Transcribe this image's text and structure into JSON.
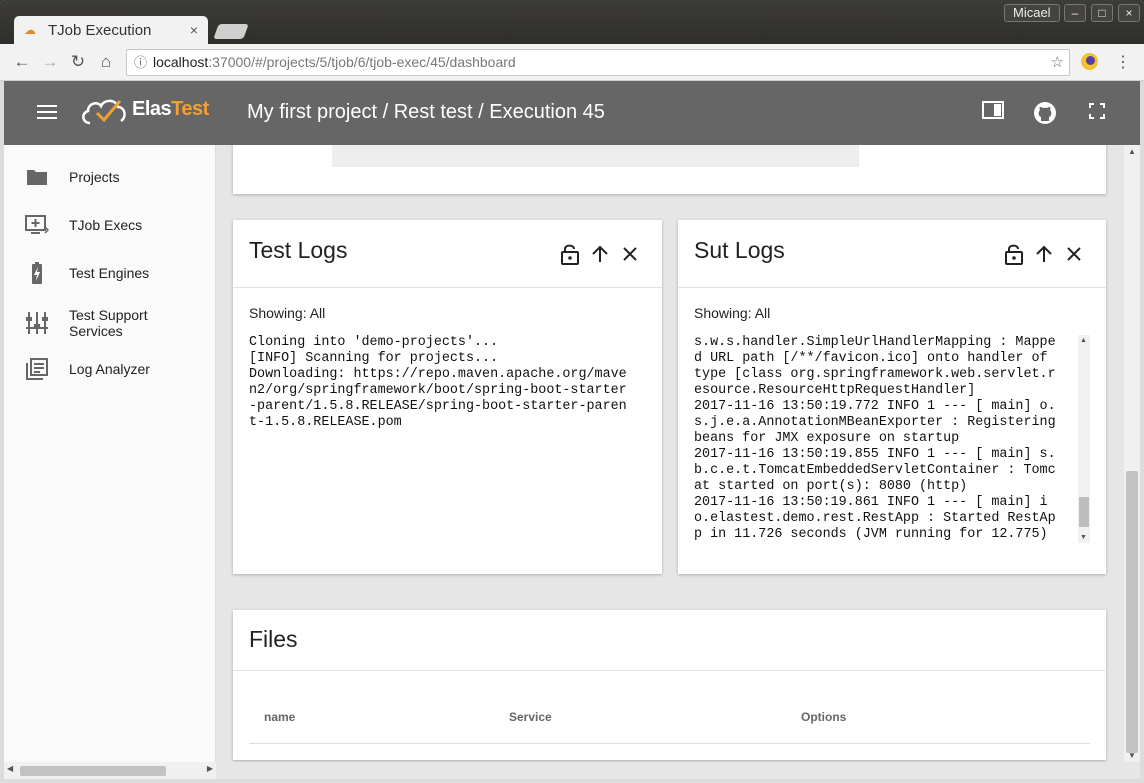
{
  "browser": {
    "tab_title": "TJob Execution",
    "tab_close": "×",
    "user_badge": "Micael",
    "window_controls": [
      "–",
      "□",
      "×"
    ],
    "url_host": "localhost",
    "url_path": ":37000/#/projects/5/tjob/6/tjob-exec/45/dashboard"
  },
  "appbar": {
    "brand_prefix": "Elas",
    "brand_suffix": "Test",
    "title": "My first project / Rest test / Execution 45"
  },
  "sidebar": {
    "items": [
      {
        "label": "Projects",
        "icon": "folder-icon"
      },
      {
        "label": "TJob Execs",
        "icon": "add-to-queue-icon"
      },
      {
        "label": "Test Engines",
        "icon": "battery-charging-icon"
      },
      {
        "label": "Test Support Services",
        "icon": "tune-sliders-icon"
      },
      {
        "label": "Log Analyzer",
        "icon": "library-books-icon"
      }
    ]
  },
  "test_logs": {
    "title": "Test Logs",
    "showing": "Showing: All",
    "content": "Cloning into 'demo-projects'...\n[INFO] Scanning for projects...\nDownloading: https://repo.maven.apache.org/mave\nn2/org/springframework/boot/spring-boot-starter\n-parent/1.5.8.RELEASE/spring-boot-starter-paren\nt-1.5.8.RELEASE.pom"
  },
  "sut_logs": {
    "title": "Sut Logs",
    "showing": "Showing: All",
    "content": "s.w.s.handler.SimpleUrlHandlerMapping : Mappe\nd URL path [/**/favicon.ico] onto handler of\ntype [class org.springframework.web.servlet.r\nesource.ResourceHttpRequestHandler]\n2017-11-16 13:50:19.772 INFO 1 --- [ main] o.\ns.j.e.a.AnnotationMBeanExporter : Registering\nbeans for JMX exposure on startup\n2017-11-16 13:50:19.855 INFO 1 --- [ main] s.\nb.c.e.t.TomcatEmbeddedServletContainer : Tomc\nat started on port(s): 8080 (http)\n2017-11-16 13:50:19.861 INFO 1 --- [ main] i\no.elastest.demo.rest.RestApp : Started RestAp\np in 11.726 seconds (JVM running for 12.775)"
  },
  "files": {
    "title": "Files",
    "columns": [
      "name",
      "Service",
      "Options"
    ]
  },
  "colors": {
    "appbar": "#666666",
    "brand_accent": "#f0a035",
    "content_bg": "#e6e6e6"
  }
}
